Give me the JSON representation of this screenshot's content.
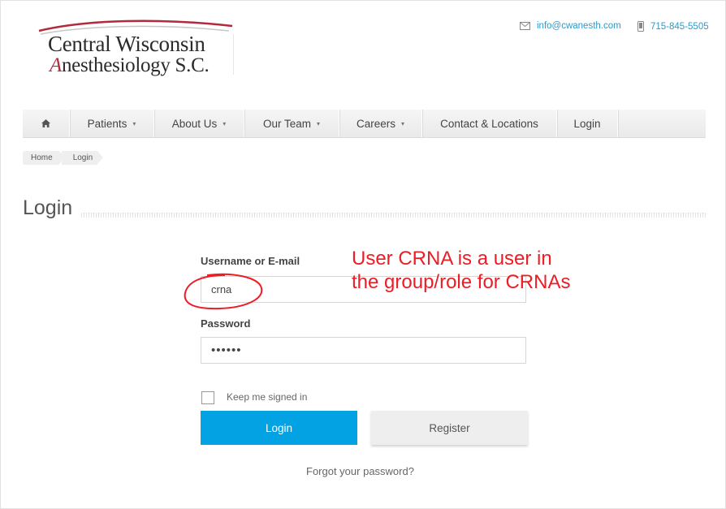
{
  "logo": {
    "line1": "Central Wisconsin",
    "line2_initial": "A",
    "line2_rest": "nesthesiology S.C."
  },
  "contact": {
    "email": "info@cwanesth.com",
    "phone": "715-845-5505",
    "email_icon": "envelope-icon",
    "phone_icon": "mobile-phone-icon"
  },
  "nav": {
    "home_icon": "home-icon",
    "items": [
      "Patients",
      "About Us",
      "Our Team",
      "Careers",
      "Contact & Locations",
      "Login"
    ]
  },
  "breadcrumb": [
    "Home",
    "Login"
  ],
  "page": {
    "title": "Login"
  },
  "form": {
    "username_label": "Username or E-mail",
    "username_value": "crna",
    "password_label": "Password",
    "password_value": "••••••",
    "remember_label": "Keep me signed in",
    "login_button": "Login",
    "register_button": "Register",
    "forgot_link": "Forgot your password?"
  },
  "annotation": {
    "line1": "User CRNA is a user in",
    "line2": "the group/role for CRNAs",
    "color": "#ee1c24"
  },
  "colors": {
    "accent": "#03a3e3",
    "link": "#2c9ac9",
    "logo_red": "#b22a3c"
  }
}
